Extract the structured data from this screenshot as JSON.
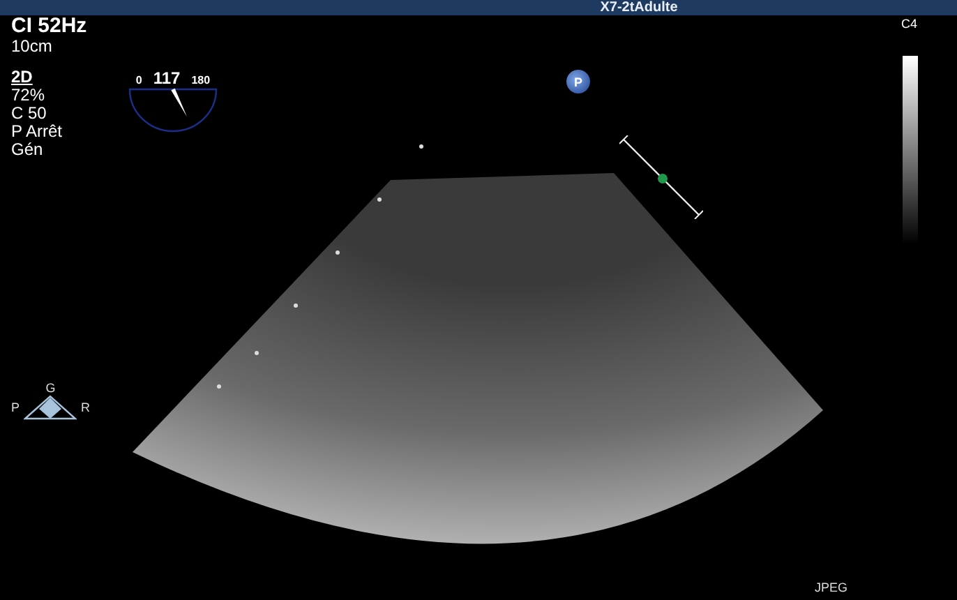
{
  "header": {
    "probe": "X7-2tAdulte"
  },
  "settings": {
    "frequency": "CI 52Hz",
    "depth": "10cm"
  },
  "mode": {
    "title": "2D",
    "values": [
      "72%",
      "C 50",
      "P Arrêt",
      "Gén"
    ]
  },
  "angle_dial": {
    "min": "0",
    "value": "117",
    "max": "180"
  },
  "marker": {
    "label": "P"
  },
  "gray_map": {
    "label": "C4"
  },
  "orientation": {
    "top": "G",
    "left": "P",
    "right": "R"
  },
  "footer": {
    "format": "JPEG"
  }
}
